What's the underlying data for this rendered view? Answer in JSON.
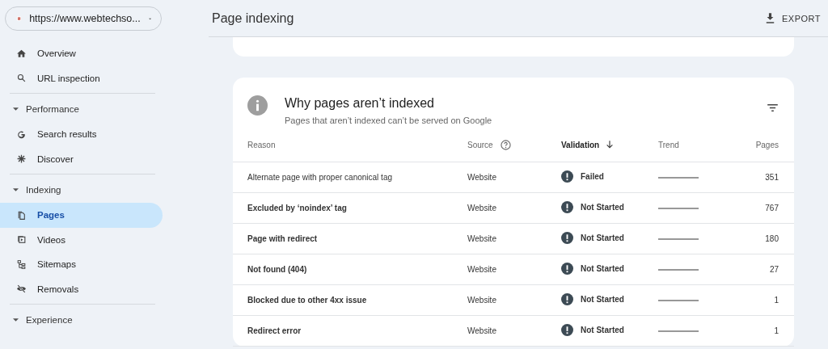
{
  "property": {
    "url": "https://www.webtechso..."
  },
  "sidebar": {
    "items": [
      {
        "label": "Overview",
        "selected": false
      },
      {
        "label": "URL inspection",
        "selected": false
      }
    ],
    "sections": [
      {
        "label": "Performance",
        "expanded": true,
        "items": [
          {
            "label": "Search results",
            "selected": false
          },
          {
            "label": "Discover",
            "selected": false
          }
        ]
      },
      {
        "label": "Indexing",
        "expanded": true,
        "items": [
          {
            "label": "Pages",
            "selected": true
          },
          {
            "label": "Videos",
            "selected": false
          },
          {
            "label": "Sitemaps",
            "selected": false
          },
          {
            "label": "Removals",
            "selected": false
          }
        ]
      },
      {
        "label": "Experience",
        "expanded": true
      }
    ]
  },
  "header": {
    "title": "Page indexing",
    "export": "EXPORT"
  },
  "card": {
    "title": "Why pages aren’t indexed",
    "subtitle": "Pages that aren’t indexed can’t be served on Google",
    "columns": {
      "reason": "Reason",
      "source": "Source",
      "validation": "Validation",
      "trend": "Trend",
      "pages": "Pages"
    },
    "rows": [
      {
        "reason": "Alternate page with proper canonical tag",
        "bold": false,
        "source": "Website",
        "validation": "Failed",
        "pages": "351"
      },
      {
        "reason": "Excluded by ‘noindex’ tag",
        "bold": true,
        "source": "Website",
        "validation": "Not Started",
        "pages": "767"
      },
      {
        "reason": "Page with redirect",
        "bold": true,
        "source": "Website",
        "validation": "Not Started",
        "pages": "180"
      },
      {
        "reason": "Not found (404)",
        "bold": true,
        "source": "Website",
        "validation": "Not Started",
        "pages": "27"
      },
      {
        "reason": "Blocked due to other 4xx issue",
        "bold": true,
        "source": "Website",
        "validation": "Not Started",
        "pages": "1"
      },
      {
        "reason": "Redirect error",
        "bold": true,
        "source": "Website",
        "validation": "Not Started",
        "pages": "1"
      }
    ]
  }
}
